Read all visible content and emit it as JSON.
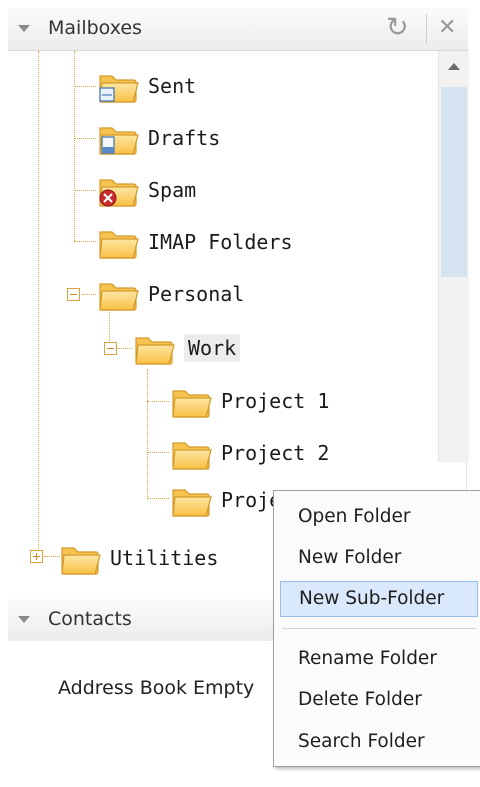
{
  "mailboxes_header": {
    "title": "Mailboxes",
    "refresh_glyph": "↻",
    "close_glyph": "✕"
  },
  "tree": {
    "items": [
      {
        "label": "Sent",
        "icon": "folder-sent-icon"
      },
      {
        "label": "Drafts",
        "icon": "folder-drafts-icon"
      },
      {
        "label": "Spam",
        "icon": "folder-spam-icon"
      },
      {
        "label": "IMAP Folders",
        "icon": "folder-icon"
      },
      {
        "label": "Personal",
        "icon": "folder-icon",
        "expanded": true
      },
      {
        "label": "Work",
        "icon": "folder-icon",
        "expanded": true,
        "selected": true
      },
      {
        "label": "Project 1",
        "icon": "folder-icon"
      },
      {
        "label": "Project 2",
        "icon": "folder-icon"
      },
      {
        "label": "Proje",
        "icon": "folder-icon"
      },
      {
        "label": "Utilities",
        "icon": "folder-icon",
        "expanded": false
      }
    ]
  },
  "contacts_header": {
    "title": "Contacts"
  },
  "contacts": {
    "empty_text": "Address Book Empty"
  },
  "context_menu": {
    "items": [
      {
        "label": "Open Folder"
      },
      {
        "label": "New Folder"
      },
      {
        "label": "New Sub-Folder",
        "highlighted": true
      },
      {
        "label": "Rename Folder"
      },
      {
        "label": "Delete Folder"
      },
      {
        "label": "Search Folder"
      }
    ]
  },
  "colors": {
    "folder_fill": "#fcd36d",
    "folder_stroke": "#d49a2a",
    "highlight": "#d9e8fb",
    "tree_line": "#d9a441"
  }
}
